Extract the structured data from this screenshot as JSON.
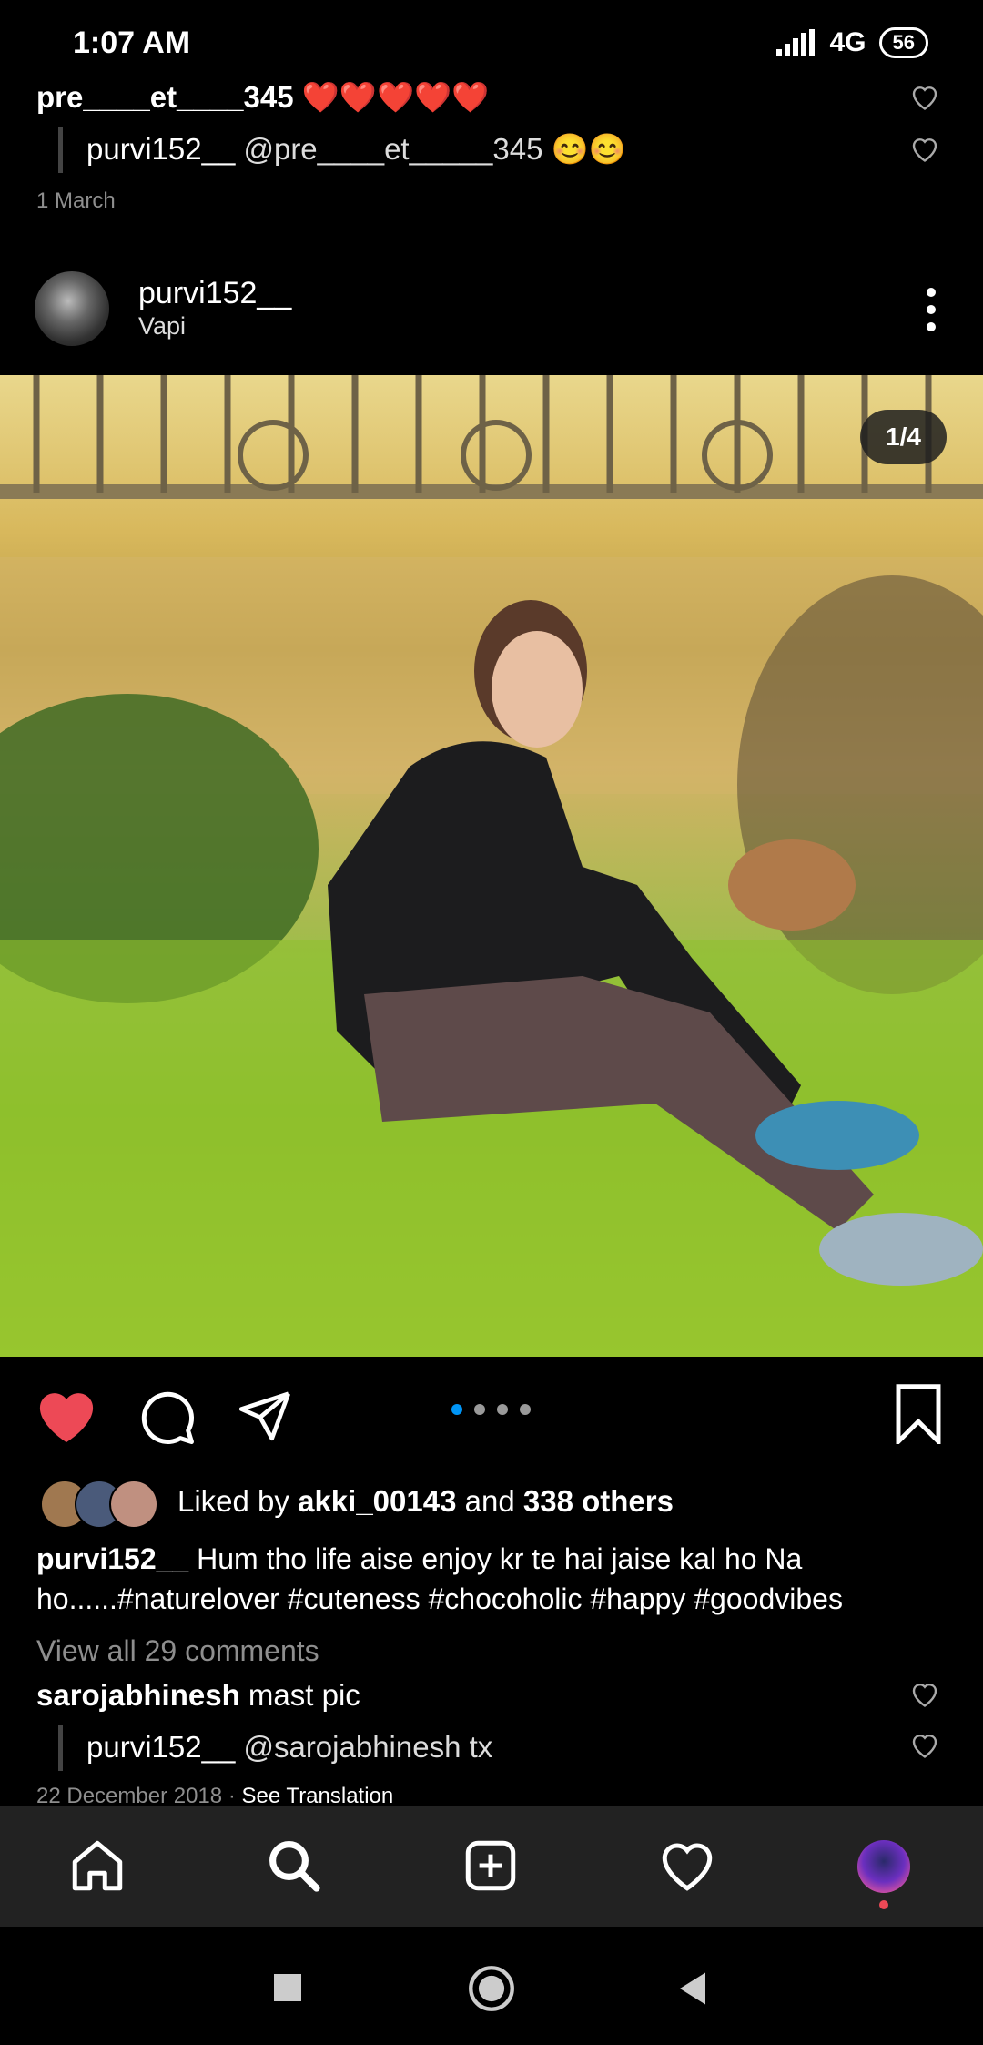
{
  "status_bar": {
    "time": "1:07 AM",
    "network": "4G",
    "battery": "56"
  },
  "comments_top": [
    {
      "user": "pre____et____345",
      "text": "❤️❤️❤️❤️❤️"
    },
    {
      "user": "purvi152__",
      "text": "@pre____et_____345 😊😊"
    }
  ],
  "comments_top_date": "1 March",
  "post": {
    "username": "purvi152__",
    "location": "Vapi",
    "image_counter": "1/4",
    "liked_by_prefix": "Liked by",
    "liked_by_user": "akki_00143",
    "liked_by_and": "and",
    "liked_by_others": "338 others",
    "caption_user": "purvi152__",
    "caption_text": "Hum tho life aise enjoy kr te hai jaise kal ho Na ho......#naturelover #cuteness #chocoholic #happy #goodvibes",
    "view_all": "View all 29 comments"
  },
  "comments_bottom": [
    {
      "user": "sarojabhinesh",
      "text": "mast  pic"
    },
    {
      "user": "purvi152__",
      "text": "@sarojabhinesh tx"
    }
  ],
  "comments_bottom_date": "22 December 2018",
  "see_translation": "See Translation",
  "colors": {
    "like_red": "#ed4956",
    "accent_blue": "#0095f6",
    "nav_bg": "#222222"
  }
}
